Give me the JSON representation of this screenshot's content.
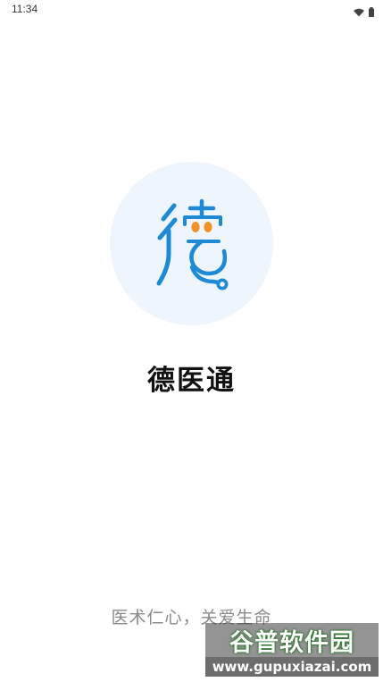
{
  "status_bar": {
    "time": "11:34",
    "icons": [
      "wifi-icon",
      "battery-icon"
    ]
  },
  "logo": {
    "icon": "de-character-stethoscope-logo",
    "colors": {
      "circle_bg": "#eef5fc",
      "primary": "#1e8ad6",
      "accent": "#f0922a"
    }
  },
  "app": {
    "name": "德医通",
    "slogan": "医术仁心，关爱生命"
  },
  "watermark": {
    "title": "谷普软件园",
    "url": "www.gupuxiazai.com"
  }
}
